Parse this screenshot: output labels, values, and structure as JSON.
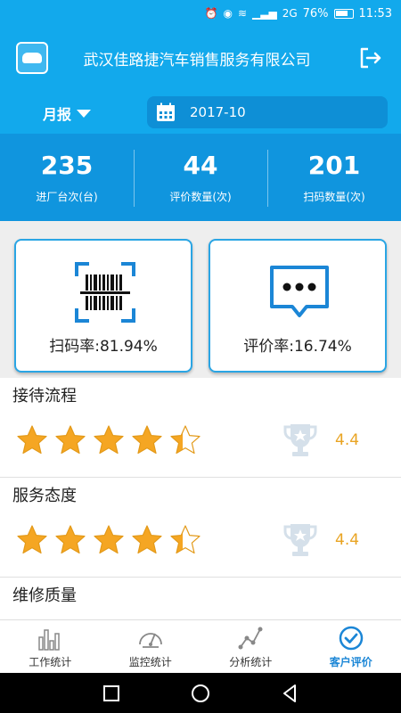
{
  "status_bar": {
    "battery": "76%",
    "time": "11:53",
    "network": "2G"
  },
  "header": {
    "title": "武汉佳路捷汽车销售服务有限公司"
  },
  "filter": {
    "period": "月报",
    "date": "2017-10"
  },
  "stats": [
    {
      "value": "235",
      "label": "进厂台次(台)"
    },
    {
      "value": "44",
      "label": "评价数量(次)"
    },
    {
      "value": "201",
      "label": "扫码数量(次)"
    }
  ],
  "cards": {
    "scan": {
      "text": "扫码率:81.94%"
    },
    "review": {
      "text": "评价率:16.74%"
    }
  },
  "ratings": [
    {
      "title": "接待流程",
      "score": "4.4",
      "rating": 4.4
    },
    {
      "title": "服务态度",
      "score": "4.4",
      "rating": 4.4
    },
    {
      "title": "维修质量"
    }
  ],
  "tabs": [
    {
      "label": "工作统计",
      "icon": "bar-chart-icon"
    },
    {
      "label": "监控统计",
      "icon": "gauge-icon"
    },
    {
      "label": "分析统计",
      "icon": "line-chart-icon"
    },
    {
      "label": "客户评价",
      "icon": "check-circle-icon",
      "active": true
    }
  ],
  "colors": {
    "primary": "#12a9ec",
    "stats_bg": "#1095de",
    "star": "#f5a623",
    "score": "#e9a423",
    "active_tab": "#1b86d6"
  }
}
